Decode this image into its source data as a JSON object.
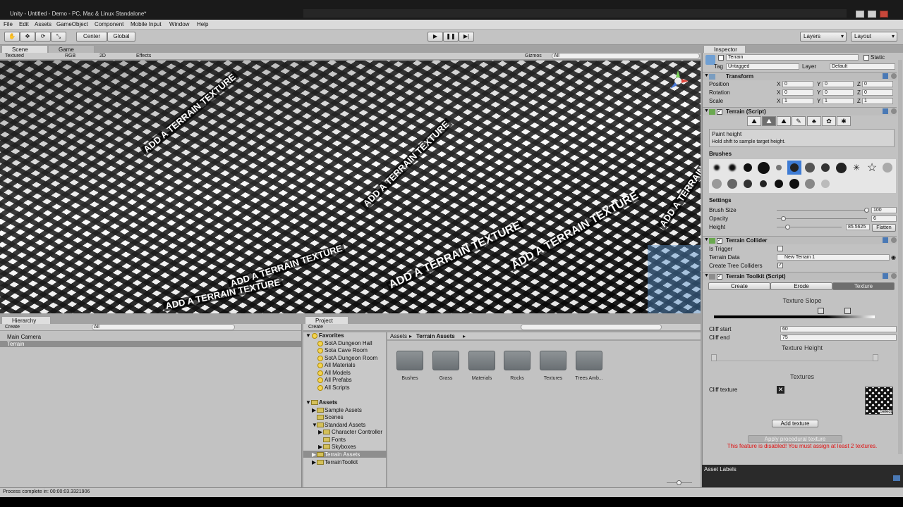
{
  "window": {
    "title": "Unity - Untitled - Demo - PC, Mac & Linux Standalone*"
  },
  "menu": [
    "File",
    "Edit",
    "Assets",
    "GameObject",
    "Component",
    "Mobile Input",
    "Window",
    "Help"
  ],
  "toolbar": {
    "pivot": "Center",
    "space": "Global",
    "layers": "Layers",
    "layout": "Layout"
  },
  "scene": {
    "tabs": [
      "Scene",
      "Game"
    ],
    "shading": "Textured",
    "render": "RGB",
    "mode2d": "2D",
    "effects": "Effects",
    "gizmos": "Gizmos",
    "search_placeholder": "All",
    "terrain_label": "ADD A TERRAIN TEXTURE"
  },
  "hierarchy": {
    "tab": "Hierarchy",
    "create": "Create",
    "search_placeholder": "All",
    "items": [
      "Main Camera",
      "Terrain"
    ]
  },
  "project": {
    "tab": "Project",
    "create": "Create",
    "favorites_label": "Favorites",
    "favorites": [
      "SotA Dungeon Hall",
      "Sota Cave Room",
      "SotA Dungeon Room",
      "All Materials",
      "All Models",
      "All Prefabs",
      "All Scripts"
    ],
    "assets_label": "Assets",
    "tree": [
      "Sample Assets",
      "Scenes",
      "Standard Assets",
      "Character Controller",
      "Fonts",
      "Skyboxes",
      "Terrain Assets",
      "TerrainToolkit"
    ],
    "breadcrumb": [
      "Assets",
      "Terrain Assets"
    ],
    "folders": [
      "Bushes",
      "Grass",
      "Materials",
      "Rocks",
      "Textures",
      "Trees Amb..."
    ]
  },
  "inspector": {
    "tab": "Inspector",
    "object_name": "Terrain",
    "static_label": "Static",
    "tag_label": "Tag",
    "tag_value": "Untagged",
    "layer_label": "Layer",
    "layer_value": "Default",
    "transform": {
      "title": "Transform",
      "rows": [
        {
          "label": "Position",
          "x": "0",
          "y": "0",
          "z": "0"
        },
        {
          "label": "Rotation",
          "x": "0",
          "y": "0",
          "z": "0"
        },
        {
          "label": "Scale",
          "x": "1",
          "y": "1",
          "z": "1"
        }
      ]
    },
    "terrain_script": {
      "title": "Terrain (Script)",
      "help_title": "Paint height",
      "help_text": "Hold shift to sample target height.",
      "brushes_label": "Brushes",
      "settings_label": "Settings",
      "brush_size_label": "Brush Size",
      "brush_size": "100",
      "opacity_label": "Opacity",
      "opacity": "6",
      "height_label": "Height",
      "height": "85.5625",
      "flatten": "Flatten"
    },
    "collider": {
      "title": "Terrain Collider",
      "trigger_label": "Is Trigger",
      "data_label": "Terrain Data",
      "data_value": "New Terrain 1",
      "tree_label": "Create Tree Colliders"
    },
    "toolkit": {
      "title": "Terrain Toolkit (Script)",
      "tabs": [
        "Create",
        "Erode",
        "Texture"
      ],
      "slope_title": "Texture Slope",
      "cliff_start_label": "Cliff start",
      "cliff_start": "60",
      "cliff_end_label": "Cliff end",
      "cliff_end": "75",
      "height_title": "Texture Height",
      "textures_title": "Textures",
      "cliff_texture_label": "Cliff texture",
      "select_label": "Select",
      "add_texture": "Add texture",
      "apply_button": "Apply procedural texture",
      "warning": "This feature is disabled! You must assign at least 2 textures."
    },
    "asset_labels": "Asset Labels"
  },
  "status": {
    "text": "Process complete in: 00:00:03.3321906"
  }
}
